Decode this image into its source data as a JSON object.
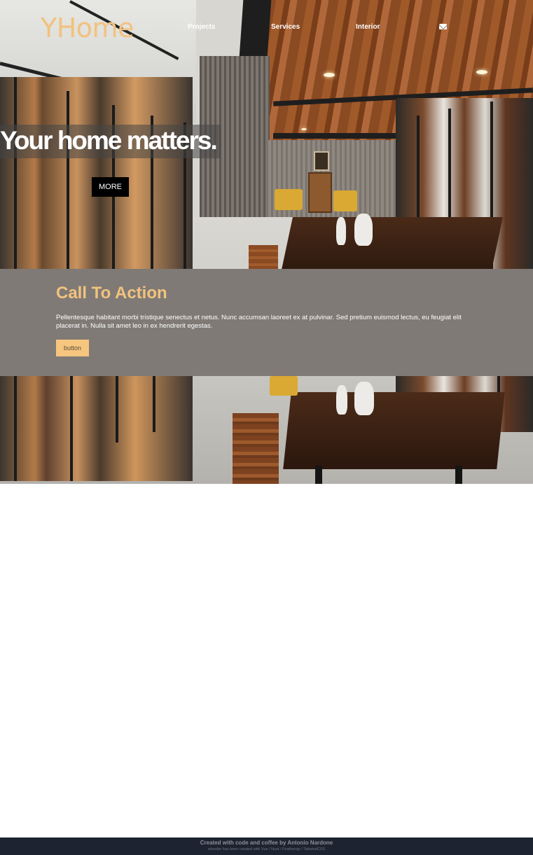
{
  "brand": {
    "logo": "YHome",
    "accent": "#f2c27e"
  },
  "nav": {
    "links": [
      "Projects",
      "Services",
      "Interior"
    ],
    "mail_icon": "envelope-icon"
  },
  "hero": {
    "title": "Your home matters.",
    "button": "MORE"
  },
  "cta": {
    "title": "Call To Action",
    "text": "Pellentesque habitant morbi tristique senectus et netus. Nunc accumsan laoreet ex at pulvinar. Sed pretium euismod lectus, eu feugiat elit placerat in. Nulla sit amet leo in ex hendrerit egestas.",
    "button": "button",
    "background": "#7f7a76",
    "button_color": "#f6c67f"
  },
  "footer": {
    "credit": "Created with code and coffee by Antonio Nardone",
    "stack": "whoobe has been created with Vue / Nuxt / Feathersjs / TailwindCSS"
  }
}
